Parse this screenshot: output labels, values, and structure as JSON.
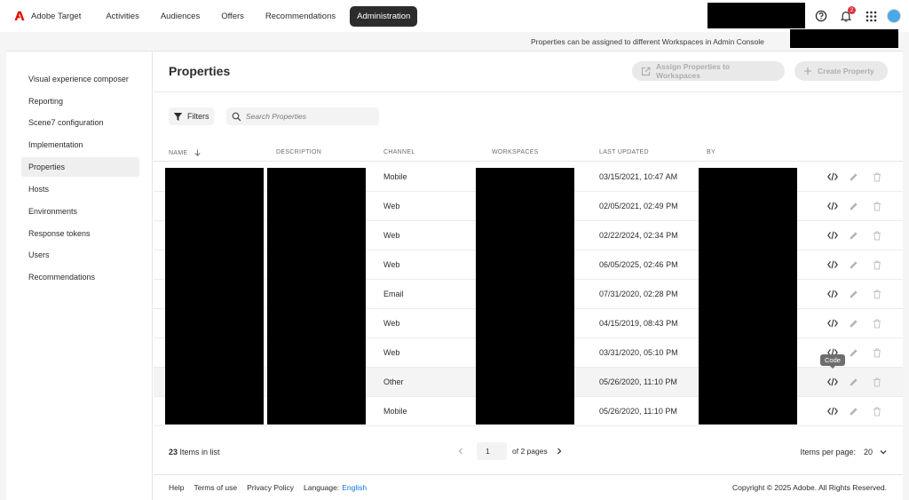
{
  "app": {
    "name": "Adobe Target"
  },
  "nav": {
    "items": [
      {
        "label": "Activities",
        "active": false
      },
      {
        "label": "Audiences",
        "active": false
      },
      {
        "label": "Offers",
        "active": false
      },
      {
        "label": "Recommendations",
        "active": false
      },
      {
        "label": "Administration",
        "active": true
      }
    ],
    "notification_count": "2"
  },
  "infobar": {
    "text": "Properties can be assigned to different Workspaces in Admin Console"
  },
  "sidebar": {
    "items": [
      {
        "label": "Visual experience composer"
      },
      {
        "label": "Reporting"
      },
      {
        "label": "Scene7 configuration"
      },
      {
        "label": "Implementation"
      },
      {
        "label": "Properties",
        "active": true
      },
      {
        "label": "Hosts"
      },
      {
        "label": "Environments"
      },
      {
        "label": "Response tokens"
      },
      {
        "label": "Users"
      },
      {
        "label": "Recommendations"
      }
    ]
  },
  "main": {
    "title": "Properties",
    "assign_button": "Assign Properties to Workspaces",
    "create_button": "Create Property",
    "filters_label": "Filters",
    "search_placeholder": "Search Properties"
  },
  "table": {
    "columns": {
      "name": "NAME",
      "description": "DESCRIPTION",
      "channel": "CHANNEL",
      "workspaces": "WORKSPACES",
      "last_updated": "LAST UPDATED",
      "by": "BY"
    },
    "rows": [
      {
        "channel": "Mobile",
        "last_updated": "03/15/2021, 10:47 AM"
      },
      {
        "channel": "Web",
        "last_updated": "02/05/2021, 02:49 PM"
      },
      {
        "channel": "Web",
        "last_updated": "02/22/2024, 02:34 PM"
      },
      {
        "channel": "Web",
        "last_updated": "06/05/2025, 02:46 PM"
      },
      {
        "channel": "Email",
        "last_updated": "07/31/2020, 02:28 PM"
      },
      {
        "channel": "Web",
        "last_updated": "04/15/2019, 08:43 PM"
      },
      {
        "channel": "Web",
        "last_updated": "03/31/2020, 05:10 PM"
      },
      {
        "channel": "Other",
        "last_updated": "05/26/2020, 11:10 PM"
      },
      {
        "channel": "Mobile",
        "last_updated": "05/26/2020, 11:10 PM"
      }
    ],
    "tooltip": "Code"
  },
  "pagination": {
    "count_number": "23",
    "count_label": "Items in list",
    "current_page": "1",
    "of_pages": "of 2 pages",
    "per_page_label": "Items per page:",
    "per_page_value": "20"
  },
  "footer": {
    "help": "Help",
    "terms": "Terms of use",
    "privacy": "Privacy Policy",
    "language_label": "Language:",
    "language_value": "English",
    "copyright": "Copyright © 2025 Adobe. All Rights Reserved."
  },
  "colors": {
    "brand_red": "#eb1000",
    "accent_blue": "#1473e6",
    "badge_red": "#d7373f"
  }
}
